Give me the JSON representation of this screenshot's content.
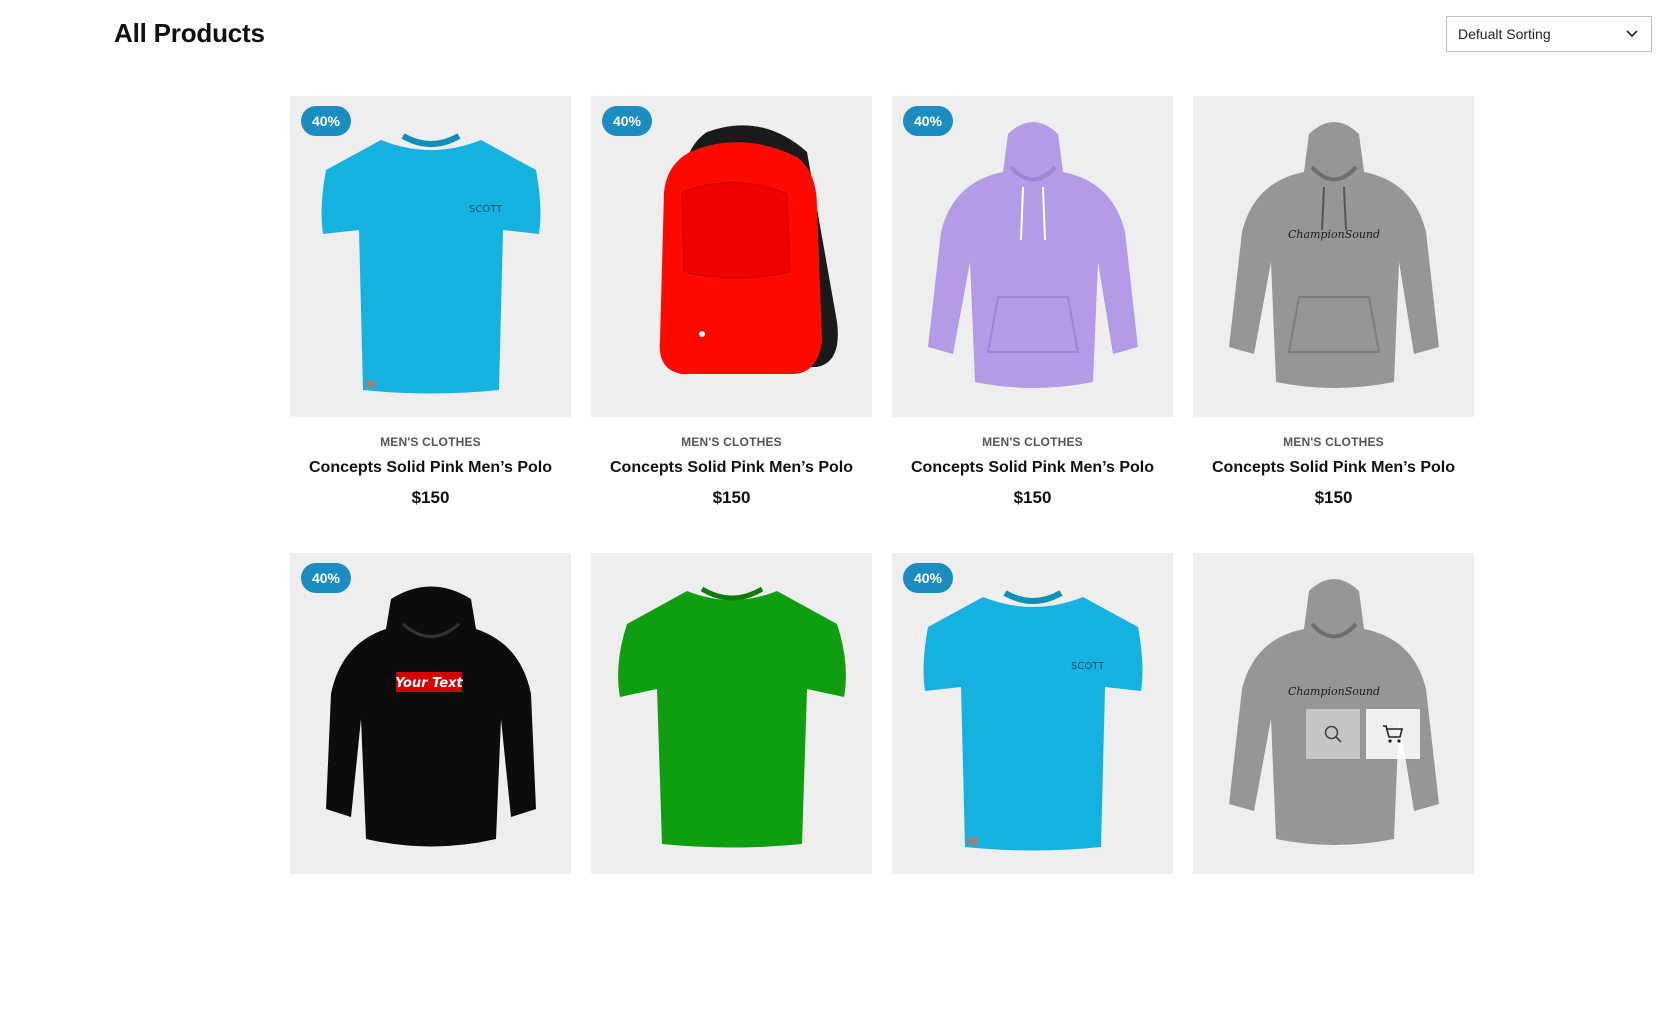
{
  "page": {
    "title": "All Products"
  },
  "sorting": {
    "selected": "Defualt Sorting",
    "icon": "chevron-down-icon"
  },
  "colors": {
    "badge": "#1b8dc1",
    "card_background": "#eeeeee"
  },
  "products": [
    {
      "badge": "40%",
      "category": "MEN'S CLOTHES",
      "name": "Concepts Solid Pink Men’s Polo",
      "price": "$150",
      "image": "blue-tshirt"
    },
    {
      "badge": "40%",
      "category": "MEN'S CLOTHES",
      "name": "Concepts Solid Pink Men’s Polo",
      "price": "$150",
      "image": "red-backpack"
    },
    {
      "badge": "40%",
      "category": "MEN'S CLOTHES",
      "name": "Concepts Solid Pink Men’s Polo",
      "price": "$150",
      "image": "purple-hoodie"
    },
    {
      "badge": "",
      "category": "MEN'S CLOTHES",
      "name": "Concepts Solid Pink Men’s Polo",
      "price": "$150",
      "image": "grey-hoodie"
    },
    {
      "badge": "40%",
      "category": "",
      "name": "",
      "price": "",
      "image": "black-hoodie",
      "print_text": "Your Text"
    },
    {
      "badge": "",
      "category": "",
      "name": "",
      "price": "",
      "image": "green-tshirt"
    },
    {
      "badge": "40%",
      "category": "",
      "name": "",
      "price": "",
      "image": "blue-tshirt"
    },
    {
      "badge": "",
      "category": "",
      "name": "",
      "price": "",
      "image": "grey-hoodie",
      "hover_actions": [
        "search-icon",
        "cart-icon"
      ]
    }
  ]
}
